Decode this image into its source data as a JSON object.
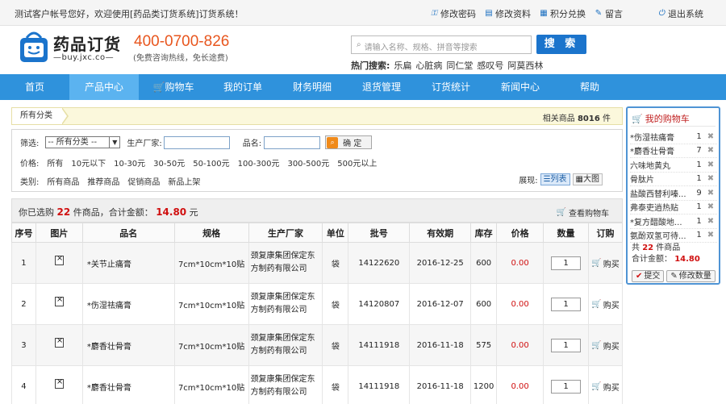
{
  "topbar": {
    "welcome": "测试客户帐号您好，欢迎使用[药品类订货系统]订货系统！",
    "links": [
      {
        "label": "修改密码",
        "icon": "key-icon"
      },
      {
        "label": "修改资料",
        "icon": "profile-icon"
      },
      {
        "label": "积分兑换",
        "icon": "points-icon"
      },
      {
        "label": "留言",
        "icon": "message-icon"
      }
    ],
    "exit": "退出系统"
  },
  "header": {
    "logo_text": "药品订货",
    "logo_sub": "—buy.jxc.co—",
    "hotline": "400-0700-826",
    "hotline_sub": "(免费咨询热线，免长途费)",
    "search_placeholder": "请输入名称、规格、拼音等搜索",
    "search_button": "搜 索",
    "hot_label": "热门搜索:",
    "hot_keywords": [
      "乐扁",
      "心脏病",
      "同仁堂",
      "感叹号",
      "阿莫西林"
    ]
  },
  "nav": [
    "首页",
    "产品中心",
    "购物车",
    "我的订单",
    "财务明细",
    "退货管理",
    "订货统计",
    "新闻中心",
    "帮助"
  ],
  "nav_active": "产品中心",
  "breadcrumb": {
    "all": "所有分类",
    "related_label": "相关商品",
    "related_count": "8016",
    "unit": "件"
  },
  "filter": {
    "screen_label": "筛选:",
    "category_select": "-- 所有分类 --",
    "manufacturer_label": "生产厂家:",
    "product_label": "品名:",
    "confirm": "确 定",
    "price_label": "价格:",
    "prices": [
      "所有",
      "10元以下",
      "10-30元",
      "30-50元",
      "50-100元",
      "100-300元",
      "300-500元",
      "500元以上"
    ],
    "type_label": "类别:",
    "types": [
      "所有商品",
      "推荐商品",
      "促销商品",
      "新品上架"
    ],
    "view_label": "展现:",
    "view_list": "列表",
    "view_grid": "大图"
  },
  "selection": {
    "prefix": "你已选购",
    "count": "22",
    "middle": "件商品，合计金额：",
    "amount": "14.80",
    "suffix": "元",
    "view_cart": "查看购物车"
  },
  "table": {
    "headers": [
      "序号",
      "图片",
      "品名",
      "规格",
      "生产厂家",
      "单位",
      "批号",
      "有效期",
      "库存",
      "价格",
      "数量",
      "订购"
    ],
    "rows": [
      {
        "no": "1",
        "name": "*关节止痛膏",
        "spec": "7cm*10cm*10贴",
        "mfr": "颈复康集团保定东方制药有限公司",
        "unit": "袋",
        "batch": "14122620",
        "expiry": "2016-12-25",
        "stock": "600",
        "price": "0.00",
        "qty": "1",
        "buy": "购买"
      },
      {
        "no": "2",
        "name": "*伤湿祛痛膏",
        "spec": "7cm*10cm*10贴",
        "mfr": "颈复康集团保定东方制药有限公司",
        "unit": "袋",
        "batch": "14120807",
        "expiry": "2016-12-07",
        "stock": "600",
        "price": "0.00",
        "qty": "1",
        "buy": "购买"
      },
      {
        "no": "3",
        "name": "*麝香壮骨膏",
        "spec": "7cm*10cm*10贴",
        "mfr": "颈复康集团保定东方制药有限公司",
        "unit": "袋",
        "batch": "14111918",
        "expiry": "2016-11-18",
        "stock": "575",
        "price": "0.00",
        "qty": "1",
        "buy": "购买"
      },
      {
        "no": "4",
        "name": "*麝香壮骨膏",
        "spec": "7cm*10cm*10贴",
        "mfr": "颈复康集团保定东方制药有限公司",
        "unit": "袋",
        "batch": "14111918",
        "expiry": "2016-11-18",
        "stock": "1200",
        "price": "0.00",
        "qty": "1",
        "buy": "购买"
      }
    ]
  },
  "cart": {
    "title": "我的购物车",
    "items": [
      {
        "name": "*伤湿祛痛膏",
        "qty": "1"
      },
      {
        "name": "*麝香壮骨膏",
        "qty": "7"
      },
      {
        "name": "六味地黄丸",
        "qty": "1"
      },
      {
        "name": "骨肽片",
        "qty": "1"
      },
      {
        "name": "盐酸西替利嗪...",
        "qty": "9"
      },
      {
        "name": "弗泰吏逍热贴",
        "qty": "1"
      },
      {
        "name": "*复方醋酸地...",
        "qty": "1"
      },
      {
        "name": "氨酚双氢可待...",
        "qty": "1"
      }
    ],
    "total_prefix": "共",
    "total_count": "22",
    "total_suffix": "件商品",
    "amount_label": "合计金额：",
    "amount": "14.80",
    "submit": "提交",
    "modify": "修改数量"
  },
  "colors": {
    "nav": "#2f92dc",
    "nav_active": "#5bb3f0",
    "accent_red": "#d01010",
    "hotline": "#e8561e",
    "search_button": "#1b74cc"
  }
}
